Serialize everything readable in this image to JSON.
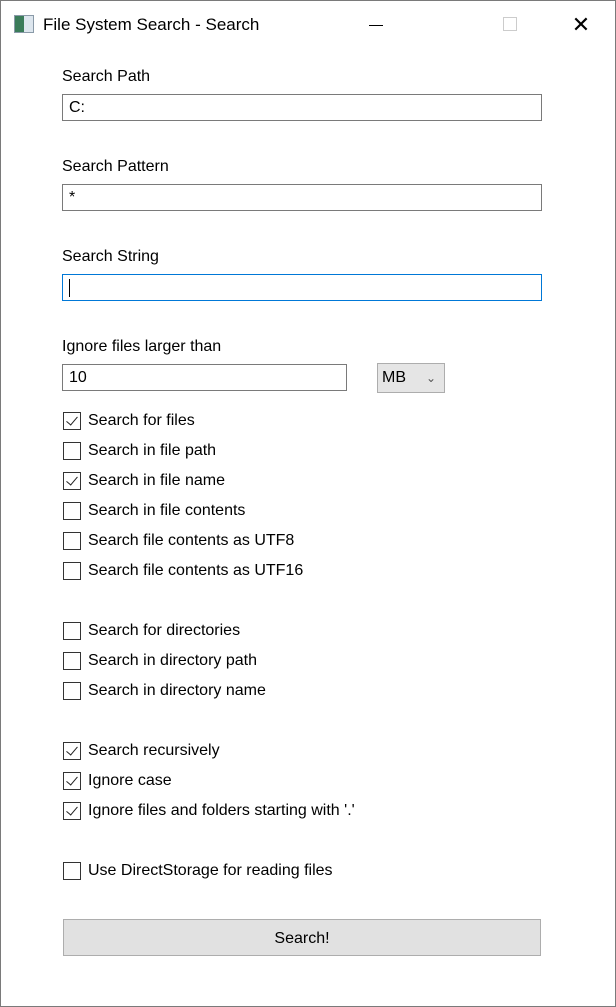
{
  "window": {
    "title": "File System Search - Search",
    "close_glyph": "✕"
  },
  "fields": {
    "path_label": "Search Path",
    "path_value": "C:",
    "pattern_label": "Search Pattern",
    "pattern_value": "*",
    "string_label": "Search String",
    "string_value": "",
    "size_label": "Ignore files larger than",
    "size_value": "10",
    "unit_value": "MB",
    "unit_chevron": "⌄"
  },
  "checkboxes": [
    {
      "label": "Search for files",
      "checked": true
    },
    {
      "label": "Search in file path",
      "checked": false
    },
    {
      "label": "Search in file name",
      "checked": true
    },
    {
      "label": "Search in file contents",
      "checked": false
    },
    {
      "label": "Search file contents as UTF8",
      "checked": false
    },
    {
      "label": "Search file contents as UTF16",
      "checked": false
    },
    {
      "label": "Search for directories",
      "checked": false
    },
    {
      "label": "Search in directory path",
      "checked": false
    },
    {
      "label": "Search in directory name",
      "checked": false
    },
    {
      "label": "Search recursively",
      "checked": true
    },
    {
      "label": "Ignore case",
      "checked": true
    },
    {
      "label": "Ignore files and folders starting with '.'",
      "checked": true
    },
    {
      "label": "Use DirectStorage for reading files",
      "checked": false
    }
  ],
  "search_button": "Search!"
}
